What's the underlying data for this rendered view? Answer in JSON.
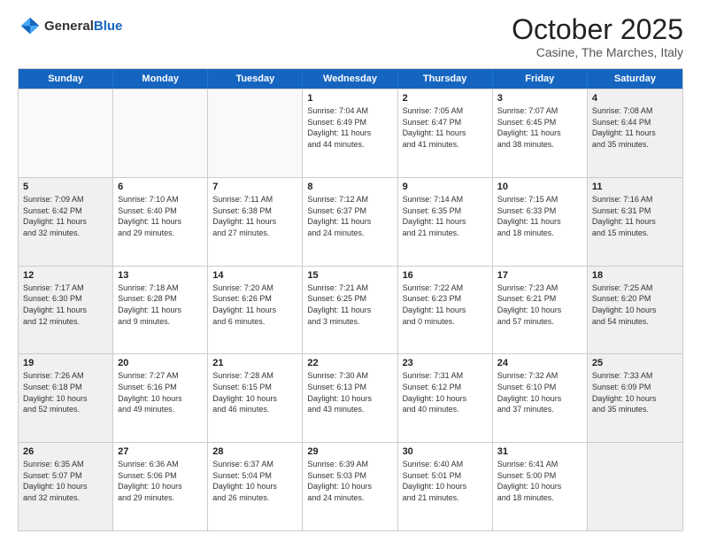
{
  "header": {
    "logo_general": "General",
    "logo_blue": "Blue",
    "month_title": "October 2025",
    "location": "Casine, The Marches, Italy"
  },
  "weekdays": [
    "Sunday",
    "Monday",
    "Tuesday",
    "Wednesday",
    "Thursday",
    "Friday",
    "Saturday"
  ],
  "rows": [
    [
      {
        "day": "",
        "text": "",
        "empty": true
      },
      {
        "day": "",
        "text": "",
        "empty": true
      },
      {
        "day": "",
        "text": "",
        "empty": true
      },
      {
        "day": "1",
        "text": "Sunrise: 7:04 AM\nSunset: 6:49 PM\nDaylight: 11 hours\nand 44 minutes.",
        "empty": false
      },
      {
        "day": "2",
        "text": "Sunrise: 7:05 AM\nSunset: 6:47 PM\nDaylight: 11 hours\nand 41 minutes.",
        "empty": false
      },
      {
        "day": "3",
        "text": "Sunrise: 7:07 AM\nSunset: 6:45 PM\nDaylight: 11 hours\nand 38 minutes.",
        "empty": false
      },
      {
        "day": "4",
        "text": "Sunrise: 7:08 AM\nSunset: 6:44 PM\nDaylight: 11 hours\nand 35 minutes.",
        "empty": false,
        "shaded": true
      }
    ],
    [
      {
        "day": "5",
        "text": "Sunrise: 7:09 AM\nSunset: 6:42 PM\nDaylight: 11 hours\nand 32 minutes.",
        "empty": false,
        "shaded": true
      },
      {
        "day": "6",
        "text": "Sunrise: 7:10 AM\nSunset: 6:40 PM\nDaylight: 11 hours\nand 29 minutes.",
        "empty": false
      },
      {
        "day": "7",
        "text": "Sunrise: 7:11 AM\nSunset: 6:38 PM\nDaylight: 11 hours\nand 27 minutes.",
        "empty": false
      },
      {
        "day": "8",
        "text": "Sunrise: 7:12 AM\nSunset: 6:37 PM\nDaylight: 11 hours\nand 24 minutes.",
        "empty": false
      },
      {
        "day": "9",
        "text": "Sunrise: 7:14 AM\nSunset: 6:35 PM\nDaylight: 11 hours\nand 21 minutes.",
        "empty": false
      },
      {
        "day": "10",
        "text": "Sunrise: 7:15 AM\nSunset: 6:33 PM\nDaylight: 11 hours\nand 18 minutes.",
        "empty": false
      },
      {
        "day": "11",
        "text": "Sunrise: 7:16 AM\nSunset: 6:31 PM\nDaylight: 11 hours\nand 15 minutes.",
        "empty": false,
        "shaded": true
      }
    ],
    [
      {
        "day": "12",
        "text": "Sunrise: 7:17 AM\nSunset: 6:30 PM\nDaylight: 11 hours\nand 12 minutes.",
        "empty": false,
        "shaded": true
      },
      {
        "day": "13",
        "text": "Sunrise: 7:18 AM\nSunset: 6:28 PM\nDaylight: 11 hours\nand 9 minutes.",
        "empty": false
      },
      {
        "day": "14",
        "text": "Sunrise: 7:20 AM\nSunset: 6:26 PM\nDaylight: 11 hours\nand 6 minutes.",
        "empty": false
      },
      {
        "day": "15",
        "text": "Sunrise: 7:21 AM\nSunset: 6:25 PM\nDaylight: 11 hours\nand 3 minutes.",
        "empty": false
      },
      {
        "day": "16",
        "text": "Sunrise: 7:22 AM\nSunset: 6:23 PM\nDaylight: 11 hours\nand 0 minutes.",
        "empty": false
      },
      {
        "day": "17",
        "text": "Sunrise: 7:23 AM\nSunset: 6:21 PM\nDaylight: 10 hours\nand 57 minutes.",
        "empty": false
      },
      {
        "day": "18",
        "text": "Sunrise: 7:25 AM\nSunset: 6:20 PM\nDaylight: 10 hours\nand 54 minutes.",
        "empty": false,
        "shaded": true
      }
    ],
    [
      {
        "day": "19",
        "text": "Sunrise: 7:26 AM\nSunset: 6:18 PM\nDaylight: 10 hours\nand 52 minutes.",
        "empty": false,
        "shaded": true
      },
      {
        "day": "20",
        "text": "Sunrise: 7:27 AM\nSunset: 6:16 PM\nDaylight: 10 hours\nand 49 minutes.",
        "empty": false
      },
      {
        "day": "21",
        "text": "Sunrise: 7:28 AM\nSunset: 6:15 PM\nDaylight: 10 hours\nand 46 minutes.",
        "empty": false
      },
      {
        "day": "22",
        "text": "Sunrise: 7:30 AM\nSunset: 6:13 PM\nDaylight: 10 hours\nand 43 minutes.",
        "empty": false
      },
      {
        "day": "23",
        "text": "Sunrise: 7:31 AM\nSunset: 6:12 PM\nDaylight: 10 hours\nand 40 minutes.",
        "empty": false
      },
      {
        "day": "24",
        "text": "Sunrise: 7:32 AM\nSunset: 6:10 PM\nDaylight: 10 hours\nand 37 minutes.",
        "empty": false
      },
      {
        "day": "25",
        "text": "Sunrise: 7:33 AM\nSunset: 6:09 PM\nDaylight: 10 hours\nand 35 minutes.",
        "empty": false,
        "shaded": true
      }
    ],
    [
      {
        "day": "26",
        "text": "Sunrise: 6:35 AM\nSunset: 5:07 PM\nDaylight: 10 hours\nand 32 minutes.",
        "empty": false,
        "shaded": true
      },
      {
        "day": "27",
        "text": "Sunrise: 6:36 AM\nSunset: 5:06 PM\nDaylight: 10 hours\nand 29 minutes.",
        "empty": false
      },
      {
        "day": "28",
        "text": "Sunrise: 6:37 AM\nSunset: 5:04 PM\nDaylight: 10 hours\nand 26 minutes.",
        "empty": false
      },
      {
        "day": "29",
        "text": "Sunrise: 6:39 AM\nSunset: 5:03 PM\nDaylight: 10 hours\nand 24 minutes.",
        "empty": false
      },
      {
        "day": "30",
        "text": "Sunrise: 6:40 AM\nSunset: 5:01 PM\nDaylight: 10 hours\nand 21 minutes.",
        "empty": false
      },
      {
        "day": "31",
        "text": "Sunrise: 6:41 AM\nSunset: 5:00 PM\nDaylight: 10 hours\nand 18 minutes.",
        "empty": false
      },
      {
        "day": "",
        "text": "",
        "empty": true,
        "shaded": true
      }
    ]
  ]
}
